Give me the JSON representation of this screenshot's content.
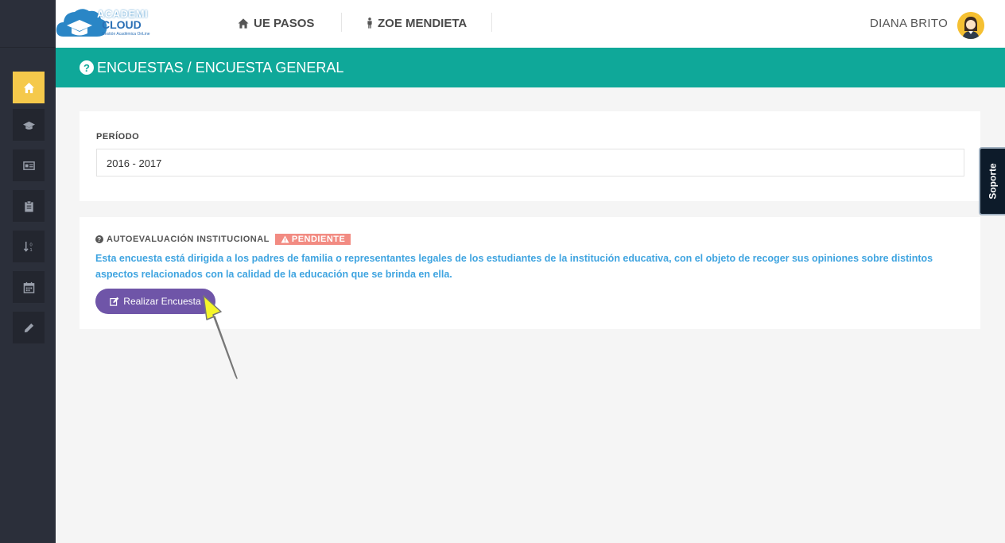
{
  "brand": {
    "line1": "ACADEMI",
    "line2": "CLOUD",
    "tagline": "Gestión Académica OnLine"
  },
  "topnav": {
    "school": "UE PASOS",
    "student": "ZOE MENDIETA",
    "user": "DIANA BRITO"
  },
  "sidebar": {
    "items": [
      {
        "icon": "home-icon",
        "active": true
      },
      {
        "icon": "graduation-cap-icon",
        "active": false
      },
      {
        "icon": "id-card-icon",
        "active": false
      },
      {
        "icon": "clipboard-icon",
        "active": false
      },
      {
        "icon": "sort-numeric-icon",
        "active": false
      },
      {
        "icon": "calendar-icon",
        "active": false
      },
      {
        "icon": "pencil-icon",
        "active": false
      }
    ]
  },
  "header": {
    "breadcrumb": "ENCUESTAS / ENCUESTA GENERAL"
  },
  "period": {
    "label": "PERÍODO",
    "value": "2016 - 2017"
  },
  "survey": {
    "title": "AUTOEVALUACIÓN INSTITUCIONAL",
    "status": "PENDIENTE",
    "description": "Esta encuesta está dirigida a los padres de familia o representantes legales de los estudiantes de la institución educativa, con el objeto de recoger sus opiniones sobre distintos aspectos relacionados con la calidad de la educación que se brinda en ella.",
    "button_label": "Realizar Encuesta"
  },
  "support_tab": "Soporte",
  "colors": {
    "sidebar": "#2b2f3a",
    "active_item": "#f5c94b",
    "header": "#0fa899",
    "button": "#6f55a8",
    "badge": "#f28b82",
    "description": "#3fa4e0"
  }
}
